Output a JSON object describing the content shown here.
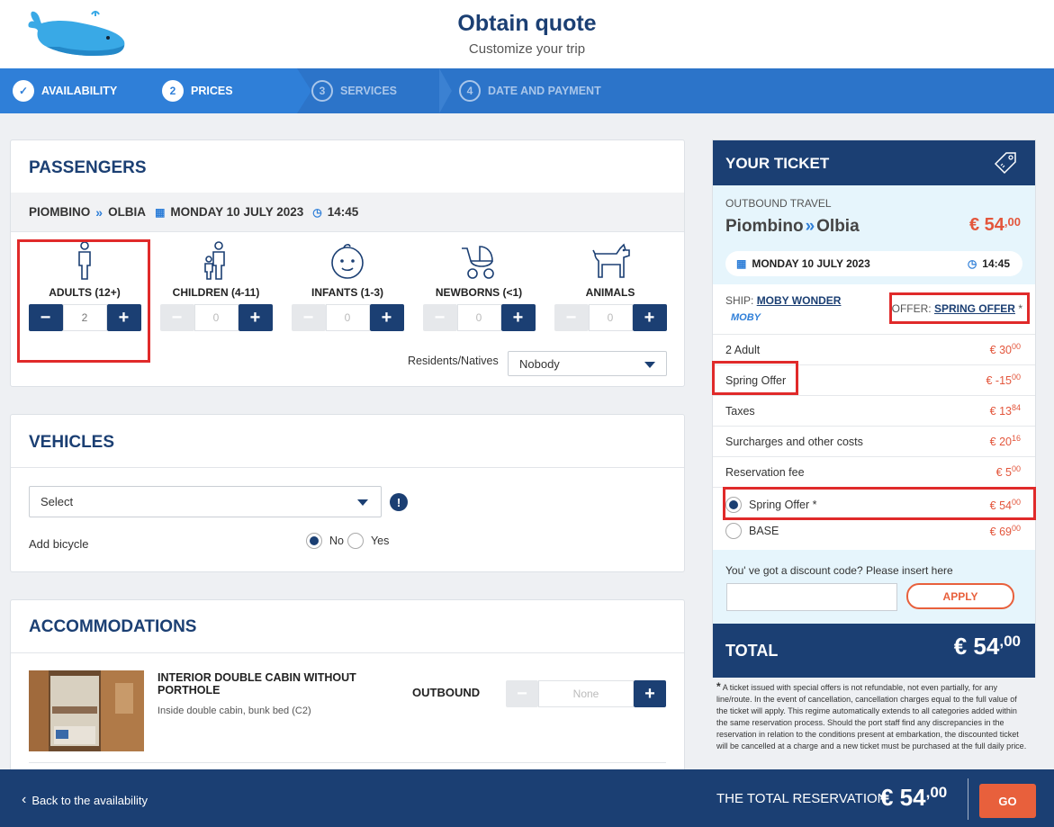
{
  "header": {
    "title": "Obtain quote",
    "subtitle": "Customize your trip"
  },
  "steps": [
    {
      "num": "✓",
      "label": "AVAILABILITY"
    },
    {
      "num": "2",
      "label": "PRICES"
    },
    {
      "num": "3",
      "label": "SERVICES"
    },
    {
      "num": "4",
      "label": "DATE AND PAYMENT"
    }
  ],
  "passengers": {
    "title": "PASSENGERS",
    "route_from": "PIOMBINO",
    "route_to": "OLBIA",
    "date": "MONDAY 10 JULY 2023",
    "time": "14:45",
    "types": [
      {
        "label": "ADULTS (12+)",
        "value": "2",
        "icon": "adult-icon"
      },
      {
        "label": "CHILDREN (4-11)",
        "value": "0",
        "icon": "children-icon"
      },
      {
        "label": "INFANTS (1-3)",
        "value": "0",
        "icon": "infant-icon"
      },
      {
        "label": "NEWBORNS (<1)",
        "value": "0",
        "icon": "stroller-icon"
      },
      {
        "label": "ANIMALS",
        "value": "0",
        "icon": "dog-icon"
      }
    ],
    "residents_label": "Residents/Natives",
    "residents_value": "Nobody"
  },
  "vehicles": {
    "title": "VEHICLES",
    "select_value": "Select",
    "bicycle_label": "Add bicycle",
    "no_label": "No",
    "yes_label": "Yes"
  },
  "accommodations": {
    "title": "ACCOMMODATIONS",
    "name_line1": "INTERIOR DOUBLE CABIN WITHOUT",
    "name_line2": "PORTHOLE",
    "description": "Inside double cabin, bunk bed (C2)",
    "direction": "OUTBOUND",
    "value": "None"
  },
  "ticket": {
    "title": "YOUR TICKET",
    "outbound_label": "OUTBOUND TRAVEL",
    "from": "Piombino",
    "to": "Olbia",
    "price_main": "€ 54",
    "price_dec": ",00",
    "date": "MONDAY 10 JULY 2023",
    "time": "14:45",
    "ship_label": "SHIP:",
    "ship_name": "MOBY WONDER",
    "brand": "MOBY",
    "offer_label": "OFFER:",
    "offer_name": "SPRING OFFER",
    "offer_star": "*",
    "lines": [
      {
        "label": "2 Adult",
        "main": "€ 30",
        "dec": "00"
      },
      {
        "label": "Spring Offer",
        "main": "€ -15",
        "dec": "00"
      },
      {
        "label": "Taxes",
        "main": "€ 13",
        "dec": "84"
      },
      {
        "label": "Surcharges and other costs",
        "main": "€ 20",
        "dec": "16"
      },
      {
        "label": "Reservation fee",
        "main": "€ 5",
        "dec": "00"
      }
    ],
    "fares": [
      {
        "label": "Spring Offer *",
        "main": "€ 54",
        "dec": "00"
      },
      {
        "label": "BASE",
        "main": "€ 69",
        "dec": "00"
      }
    ],
    "discount_label": "You' ve got a discount code? Please insert here",
    "apply_label": "APPLY",
    "total_label": "TOTAL",
    "total_main": "€ 54",
    "total_dec": ",00"
  },
  "footnote": {
    "star": "*",
    "text": "A ticket issued with special offers is not refundable, not even partially, for any line/route. In the event of cancellation, cancellation charges equal to the full value of the ticket will apply. This regime automatically extends to all categories added within the same reservation process. Should the port staff find any discrepancies in the reservation in relation to the conditions present at embarkation, the discounted ticket will be cancelled at a charge and a new ticket must be purchased at the full daily price."
  },
  "bottom": {
    "back_label": "Back to the availability",
    "total_label": "THE TOTAL RESERVATION",
    "total_main": "€ 54",
    "total_dec": ",00",
    "go_label": "GO"
  }
}
